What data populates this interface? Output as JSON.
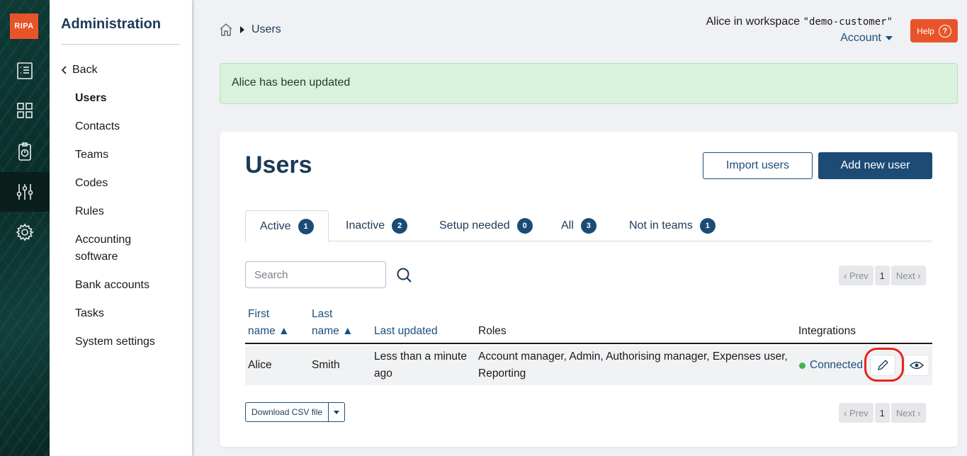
{
  "rail": {
    "logo": "RIPA",
    "items": [
      {
        "icon": "receipt-icon"
      },
      {
        "icon": "grid-icon"
      },
      {
        "icon": "clipboard-clock-icon"
      },
      {
        "icon": "sliders-icon",
        "active": true
      },
      {
        "icon": "gear-icon"
      }
    ]
  },
  "sidebar": {
    "title": "Administration",
    "back": "Back",
    "items": [
      {
        "label": "Users",
        "active": true
      },
      {
        "label": "Contacts"
      },
      {
        "label": "Teams"
      },
      {
        "label": "Codes"
      },
      {
        "label": "Rules"
      },
      {
        "label": "Accounting software"
      },
      {
        "label": "Bank accounts"
      },
      {
        "label": "Tasks"
      },
      {
        "label": "System settings"
      }
    ]
  },
  "header": {
    "breadcrumb": "Users",
    "user_prefix": "Alice in workspace ",
    "workspace": "\"demo-customer\"",
    "account": "Account",
    "help": "Help",
    "help_glyph": "?"
  },
  "alert": "Alice has been updated",
  "page": {
    "title": "Users",
    "import_button": "Import users",
    "add_button": "Add new user",
    "tabs": [
      {
        "label": "Active",
        "count": "1",
        "active": true
      },
      {
        "label": "Inactive",
        "count": "2"
      },
      {
        "label": "Setup needed",
        "count": "0"
      },
      {
        "label": "All",
        "count": "3"
      },
      {
        "label": "Not in teams",
        "count": "1"
      }
    ],
    "search_placeholder": "Search",
    "pager": {
      "prev": "‹ Prev",
      "page": "1",
      "next": "Next ›"
    },
    "columns": {
      "first_a": "First",
      "first_b": "name ▲",
      "last_a": "Last",
      "last_b": "name ▲",
      "updated": "Last updated",
      "roles": "Roles",
      "integrations": "Integrations"
    },
    "rows": [
      {
        "first": "Alice",
        "last": "Smith",
        "updated_a": "Less than a minute",
        "updated_b": "ago",
        "roles_a": "Account manager, Admin, Authorising manager, Expenses user,",
        "roles_b": "Reporting",
        "integration": "Connected"
      }
    ],
    "csv_button": "Download CSV file"
  },
  "colors": {
    "brand": "#e8542a",
    "primary": "#1c4b76",
    "success": "#3db54a",
    "highlight": "#e8241b"
  }
}
